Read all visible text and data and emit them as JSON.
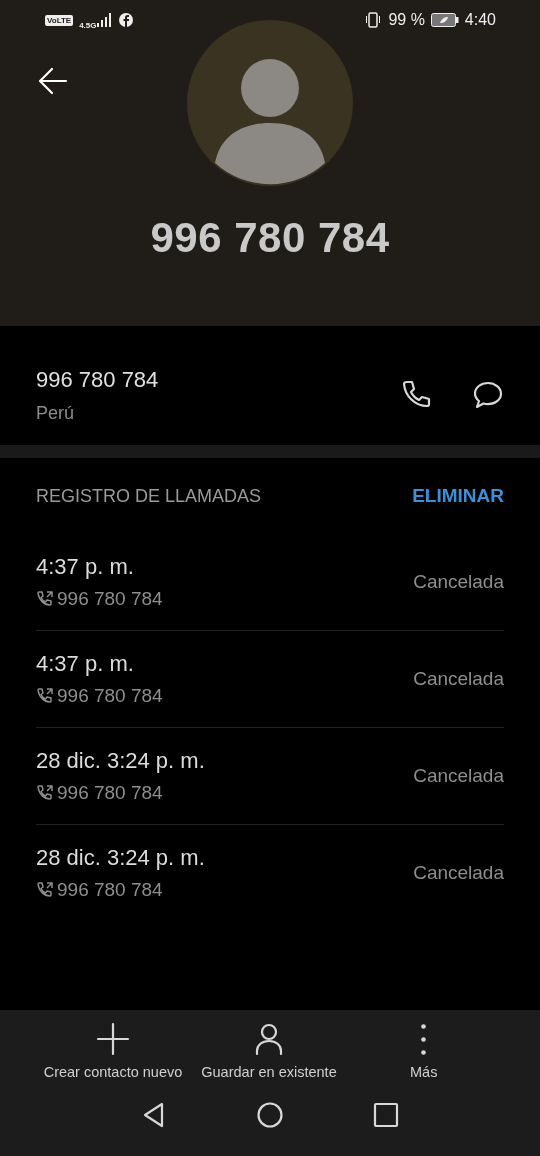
{
  "status_bar": {
    "volte": "VoLTE",
    "network": "4.5G",
    "battery": "99 %",
    "time": "4:40"
  },
  "contact": {
    "title": "996 780 784",
    "number": "996 780 784",
    "location": "Perú"
  },
  "call_log": {
    "heading": "REGISTRO DE LLAMADAS",
    "delete": "ELIMINAR",
    "rows": [
      {
        "time": "4:37 p. m.",
        "number": "996 780 784",
        "status": "Cancelada"
      },
      {
        "time": "4:37 p. m.",
        "number": "996 780 784",
        "status": "Cancelada"
      },
      {
        "time": "28 dic. 3:24 p. m.",
        "number": "996 780 784",
        "status": "Cancelada"
      },
      {
        "time": "28 dic. 3:24 p. m.",
        "number": "996 780 784",
        "status": "Cancelada"
      }
    ]
  },
  "actions": [
    {
      "kind": "add",
      "label": "Crear contacto nuevo"
    },
    {
      "kind": "person",
      "label": "Guardar en existente"
    },
    {
      "kind": "more",
      "label": "Más"
    }
  ]
}
